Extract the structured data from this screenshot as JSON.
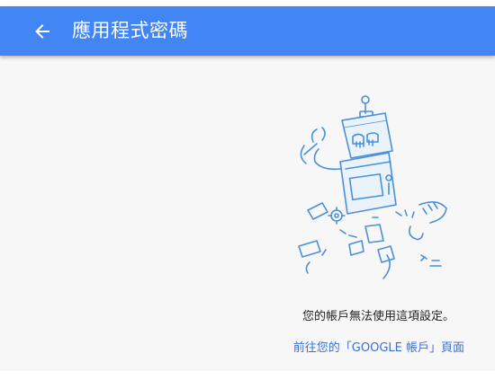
{
  "header": {
    "back_icon": "arrow-left-icon",
    "title": "應用程式密碼",
    "accent_color": "#4285f4"
  },
  "main": {
    "illustration": "broken-robot-illustration",
    "message": "您的帳戶無法使用這項設定。",
    "link_label": "前往您的「GOOGLE 帳戶」頁面",
    "link_color": "#3b6fd8"
  }
}
